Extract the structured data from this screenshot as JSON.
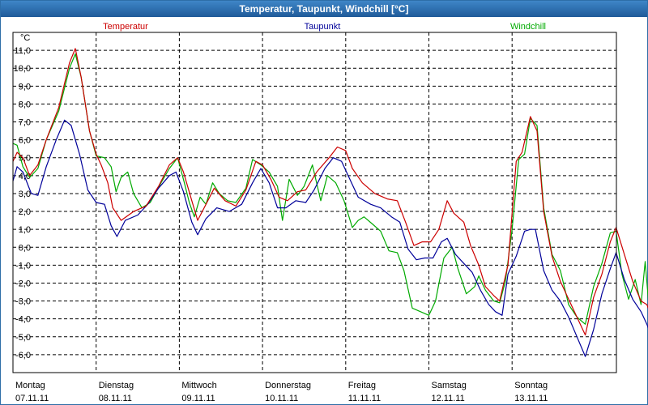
{
  "window": {
    "title": "Temperatur, Taupunkt, Windchill [°C]"
  },
  "chart_data": {
    "type": "line",
    "title": "Temperatur, Taupunkt, Windchill [°C]",
    "ylabel": "°C",
    "ylim": [
      -7,
      12
    ],
    "xlim": [
      0,
      7
    ],
    "grid": true,
    "legend_position": "top",
    "y_ticks": [
      "11,0",
      "10,0",
      "9,0",
      "8,0",
      "7,0",
      "6,0",
      "5,0",
      "4,0",
      "3,0",
      "2,0",
      "1,0",
      "0,0",
      "-1,0",
      "-2,0",
      "-3,0",
      "-4,0",
      "-5,0",
      "-6,0"
    ],
    "x_labels": [
      {
        "day": "Montag",
        "date": "07.11.11"
      },
      {
        "day": "Dienstag",
        "date": "08.11.11"
      },
      {
        "day": "Mittwoch",
        "date": "09.11.11"
      },
      {
        "day": "Donnerstag",
        "date": "10.11.11"
      },
      {
        "day": "Freitag",
        "date": "11.11.11"
      },
      {
        "day": "Samstag",
        "date": "12.11.11"
      },
      {
        "day": "Sonntag",
        "date": "13.11.11"
      }
    ],
    "series": [
      {
        "name": "Temperatur",
        "color": "#cc0000",
        "points": [
          [
            0,
            4.8
          ],
          [
            0.05,
            5.3
          ],
          [
            0.12,
            5.0
          ],
          [
            0.2,
            4.0
          ],
          [
            0.3,
            4.6
          ],
          [
            0.4,
            6.0
          ],
          [
            0.55,
            7.8
          ],
          [
            0.68,
            10.3
          ],
          [
            0.75,
            11.1
          ],
          [
            0.82,
            9.5
          ],
          [
            0.92,
            6.5
          ],
          [
            1.0,
            5.2
          ],
          [
            1.06,
            4.6
          ],
          [
            1.14,
            3.6
          ],
          [
            1.2,
            2.2
          ],
          [
            1.3,
            1.5
          ],
          [
            1.45,
            2.0
          ],
          [
            1.6,
            2.3
          ],
          [
            1.75,
            3.4
          ],
          [
            1.88,
            4.6
          ],
          [
            1.98,
            5.0
          ],
          [
            2.05,
            4.2
          ],
          [
            2.15,
            2.6
          ],
          [
            2.22,
            1.5
          ],
          [
            2.32,
            2.4
          ],
          [
            2.42,
            3.3
          ],
          [
            2.55,
            2.6
          ],
          [
            2.68,
            2.3
          ],
          [
            2.8,
            3.2
          ],
          [
            2.92,
            4.8
          ],
          [
            3.0,
            4.6
          ],
          [
            3.1,
            3.8
          ],
          [
            3.2,
            2.8
          ],
          [
            3.3,
            2.6
          ],
          [
            3.42,
            3.1
          ],
          [
            3.52,
            3.2
          ],
          [
            3.65,
            4.2
          ],
          [
            3.8,
            5.0
          ],
          [
            3.9,
            5.6
          ],
          [
            4.0,
            5.4
          ],
          [
            4.08,
            4.4
          ],
          [
            4.2,
            3.6
          ],
          [
            4.35,
            3.0
          ],
          [
            4.5,
            2.7
          ],
          [
            4.62,
            2.6
          ],
          [
            4.72,
            1.4
          ],
          [
            4.82,
            0.1
          ],
          [
            4.92,
            0.3
          ],
          [
            5.02,
            0.3
          ],
          [
            5.12,
            1.0
          ],
          [
            5.22,
            2.6
          ],
          [
            5.3,
            1.9
          ],
          [
            5.42,
            1.4
          ],
          [
            5.5,
            0.1
          ],
          [
            5.6,
            -1.0
          ],
          [
            5.68,
            -2.2
          ],
          [
            5.78,
            -2.7
          ],
          [
            5.85,
            -3.0
          ],
          [
            5.95,
            -1.0
          ],
          [
            6.05,
            4.8
          ],
          [
            6.12,
            5.3
          ],
          [
            6.22,
            7.3
          ],
          [
            6.3,
            6.5
          ],
          [
            6.38,
            2.0
          ],
          [
            6.48,
            -0.5
          ],
          [
            6.58,
            -1.9
          ],
          [
            6.68,
            -2.9
          ],
          [
            6.78,
            -3.9
          ],
          [
            6.88,
            -4.9
          ],
          [
            6.98,
            -2.8
          ],
          [
            7.08,
            -1.5
          ],
          [
            7.18,
            0.3
          ],
          [
            7.25,
            1.1
          ],
          [
            7.35,
            -0.4
          ],
          [
            7.45,
            -1.9
          ],
          [
            7.55,
            -3.0
          ],
          [
            7.62,
            -3.2
          ],
          [
            7.68,
            -3.9
          ]
        ]
      },
      {
        "name": "Taupunkt",
        "color": "#000099",
        "points": [
          [
            0,
            3.7
          ],
          [
            0.05,
            4.5
          ],
          [
            0.12,
            4.2
          ],
          [
            0.22,
            3.0
          ],
          [
            0.3,
            2.9
          ],
          [
            0.4,
            4.5
          ],
          [
            0.52,
            6.0
          ],
          [
            0.62,
            7.1
          ],
          [
            0.7,
            6.8
          ],
          [
            0.8,
            5.2
          ],
          [
            0.9,
            3.2
          ],
          [
            1.0,
            2.5
          ],
          [
            1.1,
            2.4
          ],
          [
            1.18,
            1.2
          ],
          [
            1.25,
            0.6
          ],
          [
            1.35,
            1.5
          ],
          [
            1.5,
            1.8
          ],
          [
            1.62,
            2.4
          ],
          [
            1.75,
            3.3
          ],
          [
            1.88,
            4.0
          ],
          [
            1.96,
            4.2
          ],
          [
            2.05,
            3.1
          ],
          [
            2.15,
            1.4
          ],
          [
            2.22,
            0.7
          ],
          [
            2.32,
            1.6
          ],
          [
            2.45,
            2.2
          ],
          [
            2.6,
            2.0
          ],
          [
            2.75,
            2.4
          ],
          [
            2.88,
            3.6
          ],
          [
            2.98,
            4.4
          ],
          [
            3.08,
            3.6
          ],
          [
            3.18,
            2.2
          ],
          [
            3.28,
            2.2
          ],
          [
            3.4,
            2.6
          ],
          [
            3.52,
            2.5
          ],
          [
            3.62,
            3.2
          ],
          [
            3.75,
            4.4
          ],
          [
            3.85,
            5.0
          ],
          [
            3.95,
            4.8
          ],
          [
            4.05,
            3.8
          ],
          [
            4.15,
            2.8
          ],
          [
            4.3,
            2.4
          ],
          [
            4.42,
            2.2
          ],
          [
            4.55,
            1.7
          ],
          [
            4.65,
            1.4
          ],
          [
            4.75,
            -0.1
          ],
          [
            4.85,
            -0.7
          ],
          [
            4.95,
            -0.6
          ],
          [
            5.05,
            -0.6
          ],
          [
            5.15,
            0.3
          ],
          [
            5.22,
            0.5
          ],
          [
            5.32,
            -0.4
          ],
          [
            5.42,
            -0.9
          ],
          [
            5.52,
            -1.4
          ],
          [
            5.62,
            -2.4
          ],
          [
            5.72,
            -3.2
          ],
          [
            5.8,
            -3.6
          ],
          [
            5.88,
            -3.8
          ],
          [
            5.95,
            -1.5
          ],
          [
            6.05,
            -0.5
          ],
          [
            6.15,
            0.9
          ],
          [
            6.22,
            1.0
          ],
          [
            6.28,
            1.0
          ],
          [
            6.38,
            -1.3
          ],
          [
            6.48,
            -2.4
          ],
          [
            6.58,
            -3.0
          ],
          [
            6.68,
            -3.9
          ],
          [
            6.78,
            -5.0
          ],
          [
            6.88,
            -6.1
          ],
          [
            6.98,
            -4.6
          ],
          [
            7.08,
            -2.6
          ],
          [
            7.18,
            -1.2
          ],
          [
            7.25,
            -0.3
          ],
          [
            7.35,
            -1.8
          ],
          [
            7.45,
            -2.9
          ],
          [
            7.55,
            -3.6
          ],
          [
            7.62,
            -4.3
          ],
          [
            7.68,
            -5.0
          ]
        ]
      },
      {
        "name": "Windchill",
        "color": "#00aa00",
        "points": [
          [
            0,
            5.8
          ],
          [
            0.05,
            5.7
          ],
          [
            0.12,
            4.5
          ],
          [
            0.2,
            3.9
          ],
          [
            0.3,
            4.4
          ],
          [
            0.4,
            6.0
          ],
          [
            0.55,
            7.6
          ],
          [
            0.68,
            10.0
          ],
          [
            0.75,
            10.8
          ],
          [
            0.82,
            9.5
          ],
          [
            0.92,
            6.5
          ],
          [
            1.0,
            5.1
          ],
          [
            1.1,
            5.0
          ],
          [
            1.18,
            4.5
          ],
          [
            1.24,
            3.1
          ],
          [
            1.3,
            3.9
          ],
          [
            1.38,
            4.2
          ],
          [
            1.45,
            3.0
          ],
          [
            1.55,
            2.2
          ],
          [
            1.65,
            2.5
          ],
          [
            1.78,
            3.6
          ],
          [
            1.88,
            4.4
          ],
          [
            1.98,
            5.0
          ],
          [
            2.06,
            3.6
          ],
          [
            2.12,
            2.5
          ],
          [
            2.18,
            1.7
          ],
          [
            2.25,
            2.8
          ],
          [
            2.32,
            2.4
          ],
          [
            2.4,
            3.6
          ],
          [
            2.48,
            3.0
          ],
          [
            2.58,
            2.6
          ],
          [
            2.68,
            2.5
          ],
          [
            2.8,
            3.3
          ],
          [
            2.88,
            4.9
          ],
          [
            2.98,
            4.6
          ],
          [
            3.08,
            4.2
          ],
          [
            3.18,
            3.4
          ],
          [
            3.24,
            1.5
          ],
          [
            3.32,
            3.8
          ],
          [
            3.42,
            2.9
          ],
          [
            3.5,
            3.4
          ],
          [
            3.6,
            4.6
          ],
          [
            3.7,
            2.6
          ],
          [
            3.78,
            4.0
          ],
          [
            3.88,
            3.6
          ],
          [
            3.98,
            2.6
          ],
          [
            4.08,
            1.1
          ],
          [
            4.15,
            1.5
          ],
          [
            4.22,
            1.7
          ],
          [
            4.32,
            1.3
          ],
          [
            4.42,
            0.9
          ],
          [
            4.52,
            -0.2
          ],
          [
            4.62,
            -0.3
          ],
          [
            4.7,
            -1.3
          ],
          [
            4.8,
            -3.4
          ],
          [
            4.9,
            -3.6
          ],
          [
            5.0,
            -3.8
          ],
          [
            5.08,
            -3.0
          ],
          [
            5.18,
            -0.6
          ],
          [
            5.28,
            0.0
          ],
          [
            5.35,
            -1.2
          ],
          [
            5.45,
            -2.6
          ],
          [
            5.55,
            -2.2
          ],
          [
            5.6,
            -1.6
          ],
          [
            5.68,
            -2.4
          ],
          [
            5.78,
            -3.0
          ],
          [
            5.85,
            -3.1
          ],
          [
            5.92,
            -1.9
          ],
          [
            6.0,
            1.0
          ],
          [
            6.08,
            4.9
          ],
          [
            6.15,
            5.2
          ],
          [
            6.22,
            7.2
          ],
          [
            6.3,
            6.8
          ],
          [
            6.38,
            2.2
          ],
          [
            6.48,
            -0.4
          ],
          [
            6.58,
            -1.3
          ],
          [
            6.68,
            -3.2
          ],
          [
            6.78,
            -3.9
          ],
          [
            6.88,
            -4.3
          ],
          [
            6.98,
            -2.2
          ],
          [
            7.08,
            -0.9
          ],
          [
            7.18,
            0.8
          ],
          [
            7.25,
            0.9
          ],
          [
            7.32,
            -1.5
          ],
          [
            7.4,
            -2.9
          ],
          [
            7.48,
            -1.8
          ],
          [
            7.55,
            -3.2
          ],
          [
            7.6,
            -0.8
          ],
          [
            7.65,
            -3.6
          ],
          [
            7.68,
            -3.7
          ]
        ]
      }
    ]
  }
}
